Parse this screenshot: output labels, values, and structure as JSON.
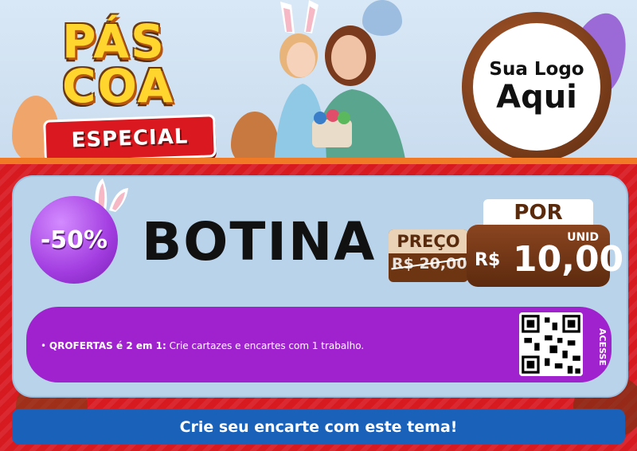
{
  "header": {
    "title_line1": "PÁS",
    "title_line2": "COA",
    "title_ribbon": "ESPECIAL",
    "logo_line1": "Sua Logo",
    "logo_line2": "Aqui"
  },
  "offer": {
    "discount": "-50%",
    "product": "BOTINA",
    "old_price_label": "PREÇO",
    "old_price_value": "R$ 20,00",
    "por_label": "POR",
    "unit_label": "UNID",
    "currency": "R$",
    "price_value": "10,00"
  },
  "promo": {
    "brand_bold": "QROFERTAS é 2 em 1:",
    "text": " Crie cartazes e encartes com 1 trabalho.",
    "qr_label": "ACESSE"
  },
  "cta": {
    "label": "Crie seu encarte com este tema!"
  },
  "colors": {
    "frame_red": "#d71920",
    "discount_purple": "#a23ce0",
    "promo_purple": "#a022cf",
    "cta_blue": "#1a61ba",
    "chocolate": "#6e3513"
  }
}
